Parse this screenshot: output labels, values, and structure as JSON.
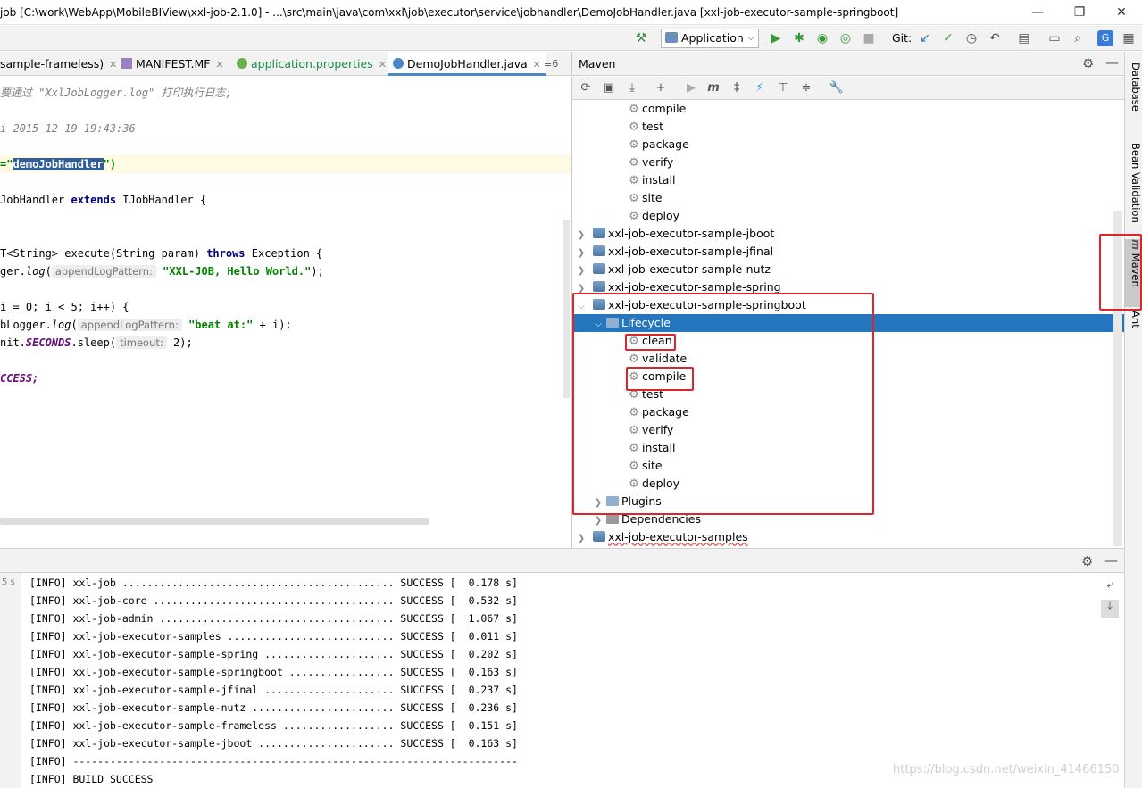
{
  "window": {
    "title": "job [C:\\work\\WebApp\\MobileBIView\\xxl-job-2.1.0] - ...\\src\\main\\java\\com\\xxl\\job\\executor\\service\\jobhandler\\DemoJobHandler.java [xxl-job-executor-sample-springboot]",
    "minimize": "—",
    "restore": "❐",
    "close": "✕"
  },
  "toolbar": {
    "run_config": "Application",
    "git_label": "Git:"
  },
  "editor_tabs": [
    {
      "label": "sample-frameless)"
    },
    {
      "label": "MANIFEST.MF"
    },
    {
      "label": "application.properties"
    },
    {
      "label": "DemoJobHandler.java"
    }
  ],
  "editor_tabs_overflow": "≡6",
  "code": {
    "l1": "要通过 \"XxlJobLogger.log\" 打印执行日志;",
    "l2": "i 2015-12-19 19:43:36",
    "l3_pre": "=\"",
    "l3_sel": "demoJobHandler",
    "l3_post": "\")",
    "l4_pre": "JobHandler ",
    "l4_kw": "extends",
    "l4_post": " IJobHandler {",
    "l5_pre": "T<String> execute(String param) ",
    "l5_kw": "throws",
    "l5_post": " Exception {",
    "l6_pre": "ger.",
    "l6_fn": "log",
    "l6_open": "(",
    "l6_hint": "appendLogPattern:",
    "l6_str": "\"XXL-JOB, Hello World.\"",
    "l6_post": ");",
    "l7": "i = 0; i < 5; i++) {",
    "l8_pre": "bLogger.",
    "l8_fn": "log",
    "l8_open": "(",
    "l8_hint": "appendLogPattern:",
    "l8_str": "\"beat at:\"",
    "l8_post": " + i);",
    "l9_pre": "nit.",
    "l9_const": "SECONDS",
    "l9_mid": ".sleep(",
    "l9_hint": "timeout:",
    "l9_post": " 2);",
    "l10": "CCESS;"
  },
  "maven": {
    "title": "Maven",
    "tree": [
      {
        "label": "compile",
        "type": "goal"
      },
      {
        "label": "test",
        "type": "goal"
      },
      {
        "label": "package",
        "type": "goal"
      },
      {
        "label": "verify",
        "type": "goal"
      },
      {
        "label": "install",
        "type": "goal"
      },
      {
        "label": "site",
        "type": "goal"
      },
      {
        "label": "deploy",
        "type": "goal"
      },
      {
        "label": "xxl-job-executor-sample-jboot",
        "type": "module"
      },
      {
        "label": "xxl-job-executor-sample-jfinal",
        "type": "module"
      },
      {
        "label": "xxl-job-executor-sample-nutz",
        "type": "module"
      },
      {
        "label": "xxl-job-executor-sample-spring",
        "type": "module"
      },
      {
        "label": "xxl-job-executor-sample-springboot",
        "type": "module"
      },
      {
        "label": "Lifecycle",
        "type": "folder"
      },
      {
        "label": "clean",
        "type": "goal"
      },
      {
        "label": "validate",
        "type": "goal"
      },
      {
        "label": "compile",
        "type": "goal"
      },
      {
        "label": "test",
        "type": "goal"
      },
      {
        "label": "package",
        "type": "goal"
      },
      {
        "label": "verify",
        "type": "goal"
      },
      {
        "label": "install",
        "type": "goal"
      },
      {
        "label": "site",
        "type": "goal"
      },
      {
        "label": "deploy",
        "type": "goal"
      },
      {
        "label": "Plugins",
        "type": "folder"
      },
      {
        "label": "Dependencies",
        "type": "folder"
      },
      {
        "label": "xxl-job-executor-samples",
        "type": "module"
      }
    ]
  },
  "right_tabs": {
    "database": "Database",
    "bean_validation": "Bean Validation",
    "maven": "Maven",
    "ant": "Ant"
  },
  "console": {
    "gutter_time": "5 s",
    "lines": [
      "[INFO] xxl-job ............................................ SUCCESS [  0.178 s]",
      "[INFO] xxl-job-core ....................................... SUCCESS [  0.532 s]",
      "[INFO] xxl-job-admin ...................................... SUCCESS [  1.067 s]",
      "[INFO] xxl-job-executor-samples ........................... SUCCESS [  0.011 s]",
      "[INFO] xxl-job-executor-sample-spring ..................... SUCCESS [  0.202 s]",
      "[INFO] xxl-job-executor-sample-springboot ................. SUCCESS [  0.163 s]",
      "[INFO] xxl-job-executor-sample-jfinal ..................... SUCCESS [  0.237 s]",
      "[INFO] xxl-job-executor-sample-nutz ....................... SUCCESS [  0.236 s]",
      "[INFO] xxl-job-executor-sample-frameless .................. SUCCESS [  0.151 s]",
      "[INFO] xxl-job-executor-sample-jboot ...................... SUCCESS [  0.163 s]",
      "[INFO] ------------------------------------------------------------------------",
      "[INFO] BUILD SUCCESS"
    ]
  },
  "watermark": "https://blog.csdn.net/weixin_41466150",
  "colors": {
    "accent": "#2675bf",
    "highlight": "#e0242a"
  }
}
